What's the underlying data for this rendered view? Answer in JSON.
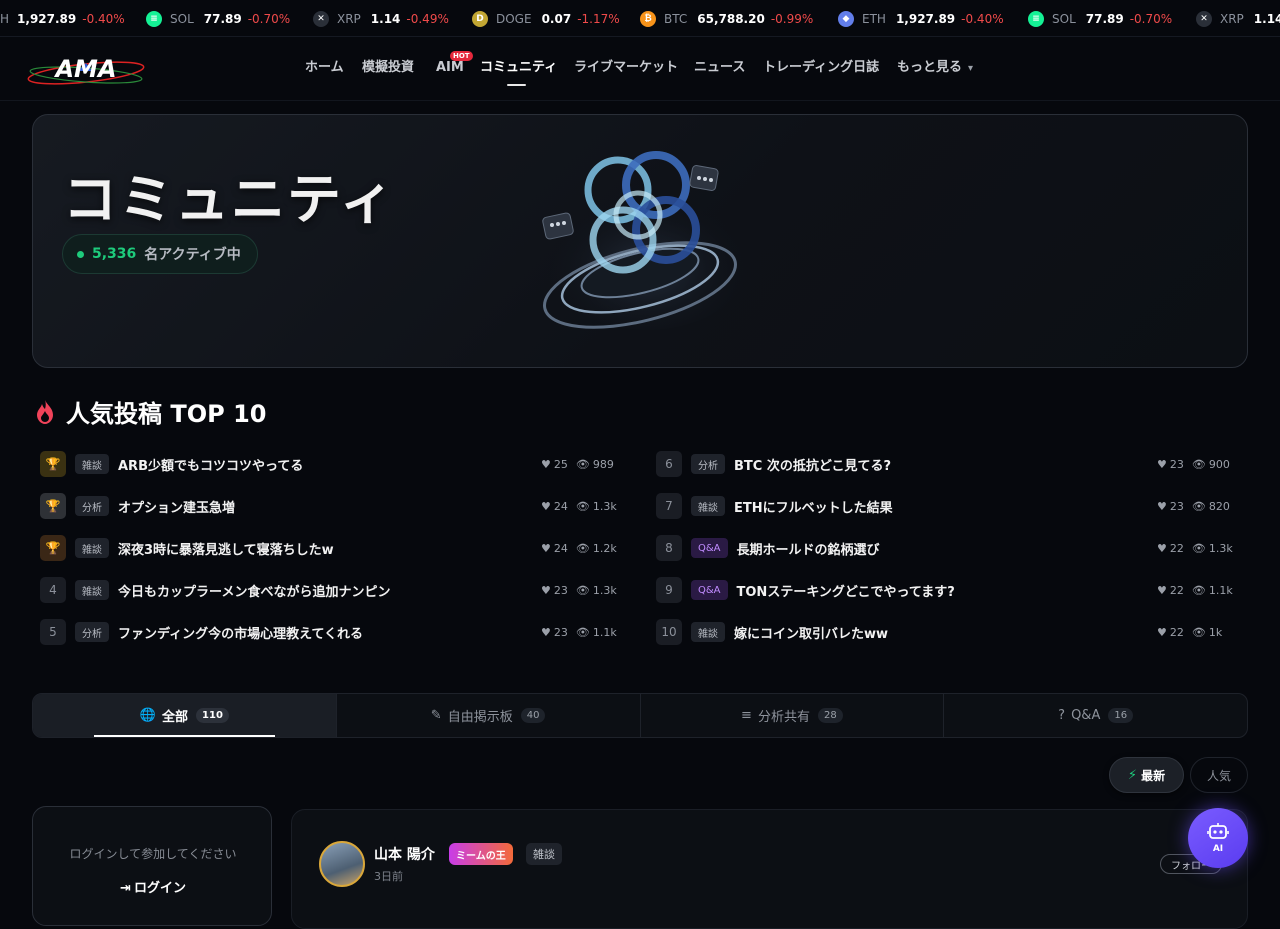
{
  "ticker": [
    {
      "icon": "eth-icon",
      "icon_text": "",
      "sym": "",
      "price": "1,927.89",
      "change": "-0.40%",
      "color": "#627eea",
      "partial": "H"
    },
    {
      "icon": "sol-icon",
      "icon_text": "≡",
      "sym": "SOL",
      "price": "77.89",
      "change": "-0.70%",
      "color": "#14f195"
    },
    {
      "icon": "xrp-icon",
      "icon_text": "✕",
      "sym": "XRP",
      "price": "1.14",
      "change": "-0.49%",
      "color": "#2a2f38"
    },
    {
      "icon": "doge-icon",
      "icon_text": "D",
      "sym": "DOGE",
      "price": "0.07",
      "change": "-1.17%",
      "color": "#c2a633"
    },
    {
      "icon": "btc-icon",
      "icon_text": "₿",
      "sym": "BTC",
      "price": "65,788.20",
      "change": "-0.99%",
      "color": "#f7931a"
    },
    {
      "icon": "eth-icon",
      "icon_text": "◆",
      "sym": "ETH",
      "price": "1,927.89",
      "change": "-0.40%",
      "color": "#627eea"
    },
    {
      "icon": "sol-icon",
      "icon_text": "≡",
      "sym": "SOL",
      "price": "77.89",
      "change": "-0.70%",
      "color": "#14f195"
    },
    {
      "icon": "xrp-icon",
      "icon_text": "✕",
      "sym": "XRP",
      "price": "1.14",
      "change": "",
      "color": "#2a2f38"
    }
  ],
  "nav": {
    "logo_text": "AMA",
    "items": [
      "ホーム",
      "模擬投資",
      "AIM",
      "コミュニティ",
      "ライブマーケット",
      "ニュース",
      "トレーディング日誌",
      "もっと見る"
    ],
    "hot_badge": "HOT",
    "more_caret": "▾"
  },
  "hero": {
    "title": "コミュニティ",
    "active_count": "5,336",
    "active_label": "名アクティブ中"
  },
  "top10": {
    "title": "人気投稿 TOP 10",
    "left": [
      {
        "rank": "🏆",
        "tag": "雑談",
        "title": "ARB少額でもコツコツやってる",
        "likes": "25",
        "views": "989",
        "kind": "gold"
      },
      {
        "rank": "🏆",
        "tag": "分析",
        "title": "オプション建玉急増",
        "likes": "24",
        "views": "1.3k",
        "kind": "silver"
      },
      {
        "rank": "🏆",
        "tag": "雑談",
        "title": "深夜3時に暴落見逃して寝落ちしたw",
        "likes": "24",
        "views": "1.2k",
        "kind": "bronze"
      },
      {
        "rank": "4",
        "tag": "雑談",
        "title": "今日もカップラーメン食べながら追加ナンピン",
        "likes": "23",
        "views": "1.3k",
        "kind": ""
      },
      {
        "rank": "5",
        "tag": "分析",
        "title": "ファンディング今の市場心理教えてくれる",
        "likes": "23",
        "views": "1.1k",
        "kind": ""
      }
    ],
    "right": [
      {
        "rank": "6",
        "tag": "分析",
        "title": "BTC 次の抵抗どこ見てる?",
        "likes": "23",
        "views": "900",
        "kind": ""
      },
      {
        "rank": "7",
        "tag": "雑談",
        "title": "ETHにフルベットした結果",
        "likes": "23",
        "views": "820",
        "kind": ""
      },
      {
        "rank": "8",
        "tag": "Q&A",
        "title": "長期ホールドの銘柄選び",
        "likes": "22",
        "views": "1.3k",
        "kind": ""
      },
      {
        "rank": "9",
        "tag": "Q&A",
        "title": "TONステーキングどこでやってます?",
        "likes": "22",
        "views": "1.1k",
        "kind": ""
      },
      {
        "rank": "10",
        "tag": "雑談",
        "title": "嫁にコイン取引バレたww",
        "likes": "22",
        "views": "1k",
        "kind": ""
      }
    ]
  },
  "tabs": [
    {
      "icon": "globe-icon",
      "glyph": "🌐",
      "label": "全部",
      "count": "110"
    },
    {
      "icon": "pencil-icon",
      "glyph": "✎",
      "label": "自由掲示板",
      "count": "40"
    },
    {
      "icon": "chart-icon",
      "glyph": "≡",
      "label": "分析共有",
      "count": "28"
    },
    {
      "icon": "question-icon",
      "glyph": "?",
      "label": "Q&A",
      "count": "16"
    }
  ],
  "sort": {
    "newest": "最新",
    "popular": "人気",
    "bolt": "⚡"
  },
  "login": {
    "message": "ログインして参加してください",
    "button": "ログイン",
    "glyph": "⇥"
  },
  "post": {
    "author": "山本 陽介",
    "badge": "ミームの王",
    "category": "雑談",
    "time": "3日前",
    "follow": "フォロー"
  },
  "ai": {
    "label": "AI"
  },
  "colors": {
    "accent_green": "#1ecb7c",
    "negative": "#ef4a4a",
    "ai_purple": "#6b4cf6"
  }
}
